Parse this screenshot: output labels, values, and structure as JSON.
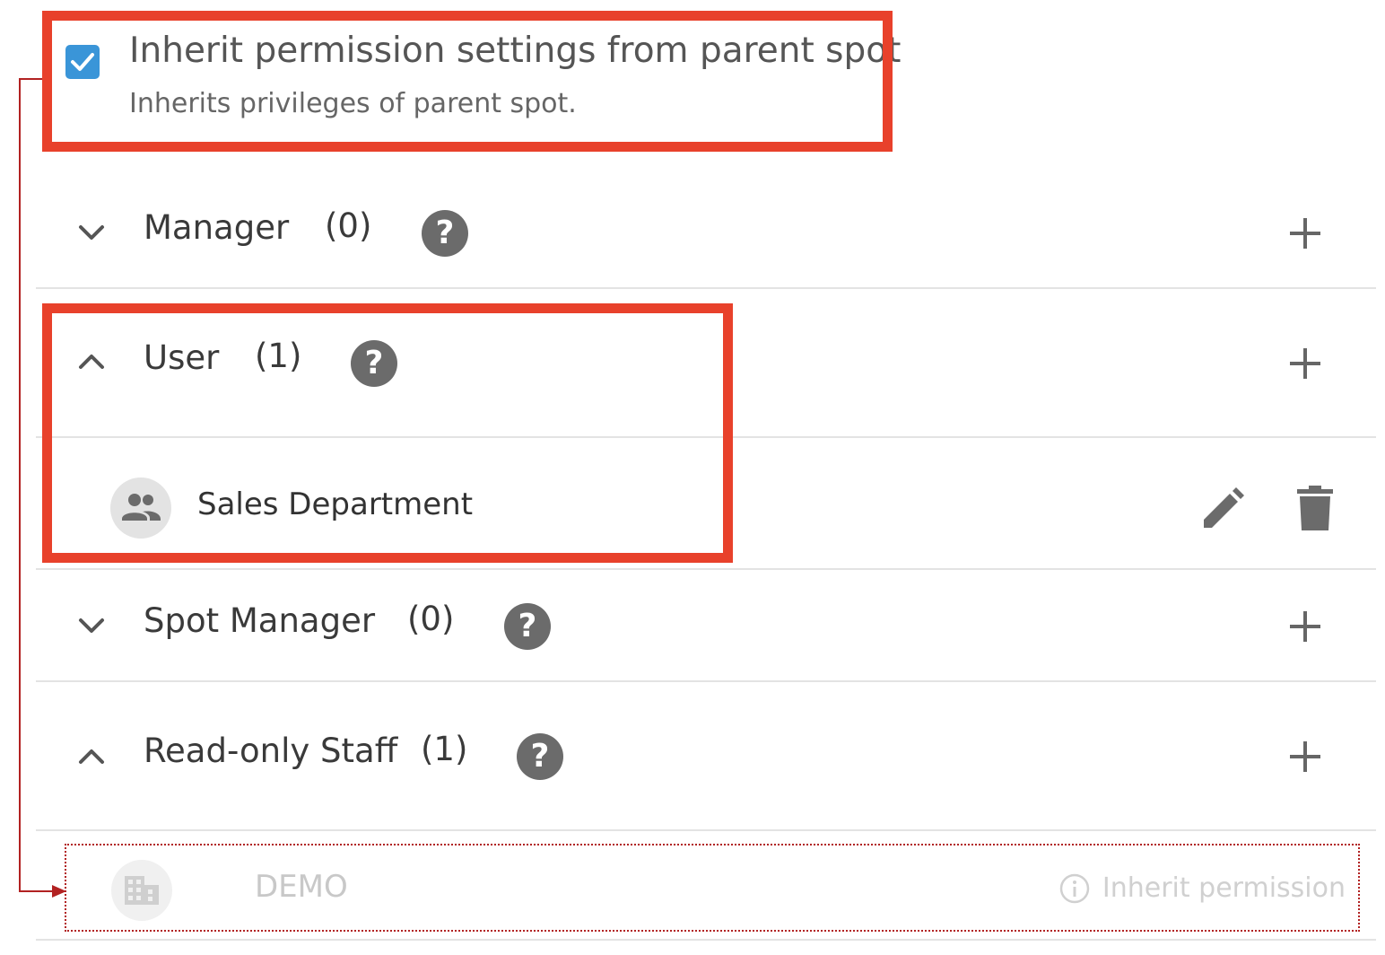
{
  "inherit": {
    "checked": true,
    "title": "Inherit permission settings from parent spot",
    "subtitle": "Inherits privileges of parent spot."
  },
  "roles": [
    {
      "label": "Manager",
      "count": "(0)",
      "expanded": false
    },
    {
      "label": "User",
      "count": "(1)",
      "expanded": true
    },
    {
      "label": "Spot Manager",
      "count": "(0)",
      "expanded": false
    },
    {
      "label": "Read-only Staff",
      "count": "(1)",
      "expanded": true
    }
  ],
  "user_members": [
    {
      "name": "Sales Department",
      "icon": "group-icon"
    }
  ],
  "readonly_members": [
    {
      "name": "DEMO",
      "icon": "building-icon",
      "note": "Inherit permission",
      "note_icon": "info-icon"
    }
  ],
  "help_glyph": "?",
  "colors": {
    "checkbox": "#3a95d8",
    "highlight": "#e8412b",
    "connector": "#b22222",
    "icon_gray": "#6b6b6b"
  }
}
